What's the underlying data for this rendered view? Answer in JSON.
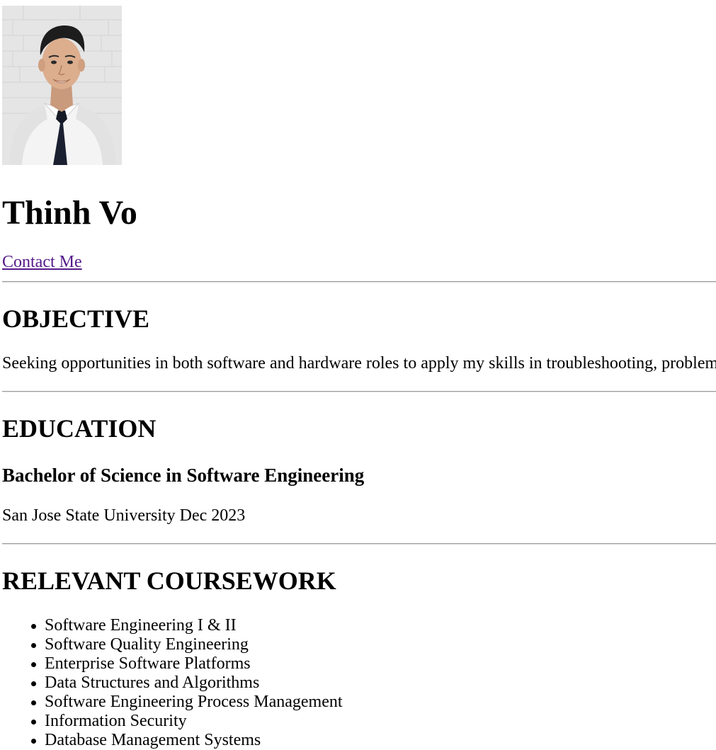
{
  "profile": {
    "photo_alt": "Thinh Vo",
    "name": "Thinh Vo",
    "contact_link": "Contact Me"
  },
  "objective": {
    "heading": "OBJECTIVE",
    "text": "Seeking opportunities in both software and hardware roles to apply my skills in troubleshooting, problem"
  },
  "education": {
    "heading": "EDUCATION",
    "degree": "Bachelor of Science in Software Engineering",
    "school_line": "San Jose State University Dec 2023"
  },
  "coursework": {
    "heading": "RELEVANT COURSEWORK",
    "items": [
      "Software Engineering I & II",
      "Software Quality Engineering",
      "Enterprise Software Platforms",
      "Data Structures and Algorithms",
      "Software Engineering Process Management",
      "Information Security",
      "Database Management Systems"
    ]
  },
  "colors": {
    "link_visited": "#551a8b",
    "rule": "#9a9a9a"
  }
}
